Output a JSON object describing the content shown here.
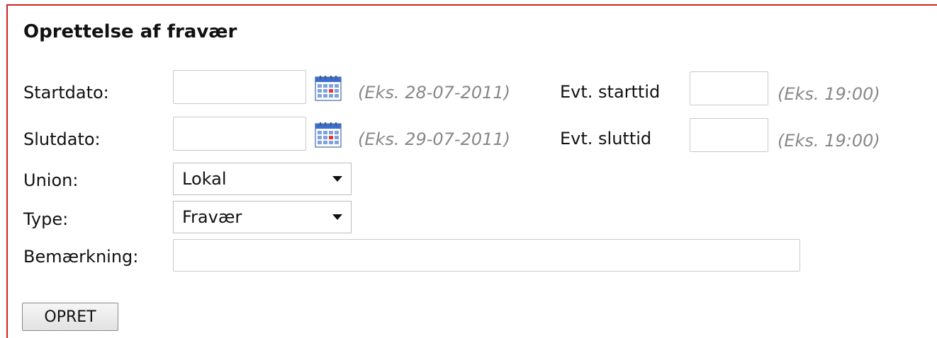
{
  "form": {
    "title": "Oprettelse af fravær",
    "startdato": {
      "label": "Startdato:",
      "value": "",
      "hint": "(Eks. 28-07-2011)"
    },
    "starttid": {
      "label": "Evt. starttid",
      "value": "",
      "hint": "(Eks. 19:00)"
    },
    "slutdato": {
      "label": "Slutdato:",
      "value": "",
      "hint": "(Eks. 29-07-2011)"
    },
    "sluttid": {
      "label": "Evt. sluttid",
      "value": "",
      "hint": "(Eks. 19:00)"
    },
    "union": {
      "label": "Union:",
      "selected": "Lokal"
    },
    "type": {
      "label": "Type:",
      "selected": "Fravær"
    },
    "bemaerkning": {
      "label": "Bemærkning:",
      "value": ""
    },
    "submit_label": "OPRET"
  },
  "colors": {
    "panel_border": "#cc2222",
    "hint_text": "#888888",
    "calendar_blue": "#3a6fd0",
    "calendar_red": "#e03a2a"
  },
  "icons": {
    "calendar": "calendar-icon",
    "dropdown": "chevron-down-icon"
  }
}
